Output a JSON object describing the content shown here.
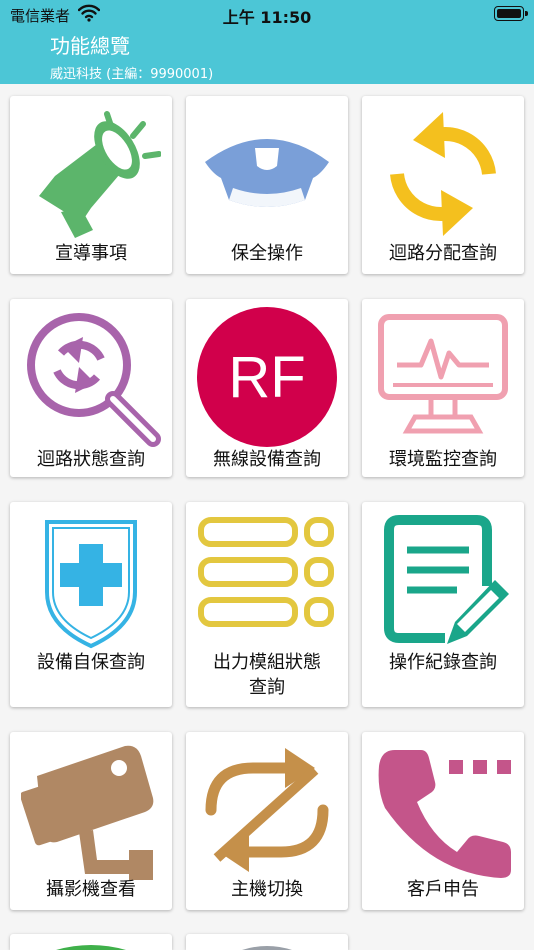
{
  "status_bar": {
    "carrier": "電信業者",
    "time": "上午 11:50"
  },
  "header": {
    "title": "功能總覽",
    "subtitle": "威迅科技 (主編：9990001)"
  },
  "tiles": [
    {
      "label": "宣導事項",
      "icon": "megaphone-icon",
      "color": "#5cb56b"
    },
    {
      "label": "保全操作",
      "icon": "guard-cap-icon",
      "color": "#7a9fd8"
    },
    {
      "label": "迴路分配查詢",
      "icon": "refresh-arrows-icon",
      "color": "#f4c01e"
    },
    {
      "label": "迴路狀態查詢",
      "icon": "search-refresh-icon",
      "color": "#a864ab"
    },
    {
      "label": "無線設備查詢",
      "icon": "rf-icon",
      "icon_text": "RF",
      "color": "#d1004b"
    },
    {
      "label": "環境監控查詢",
      "icon": "monitor-pulse-icon",
      "color": "#f0a0b0"
    },
    {
      "label": "設備自保查詢",
      "icon": "shield-cross-icon",
      "color": "#35b3e4"
    },
    {
      "label": "出力模組狀態查詢",
      "label_line1": "出力模組狀態",
      "label_line2": "查詢",
      "icon": "module-list-icon",
      "color": "#e3c73f"
    },
    {
      "label": "操作紀錄查詢",
      "icon": "document-edit-icon",
      "color": "#1aa68a"
    },
    {
      "label": "攝影機查看",
      "icon": "camera-icon",
      "color": "#b08864"
    },
    {
      "label": "主機切換",
      "icon": "host-switch-icon",
      "color": "#c5904a"
    },
    {
      "label": "客戶申告",
      "icon": "phone-icon",
      "color": "#c4558a"
    }
  ]
}
